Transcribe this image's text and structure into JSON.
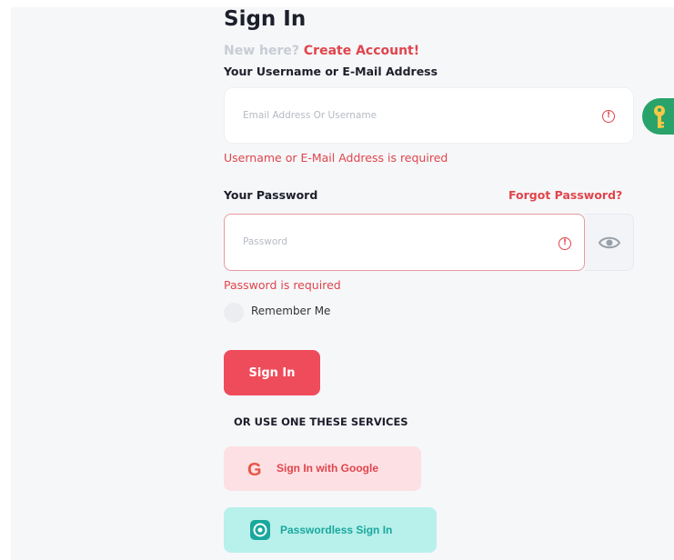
{
  "header": {
    "title": "Sign In",
    "new_here": "New here?",
    "create_account": "Create Account!"
  },
  "username": {
    "label": "Your Username or E-Mail Address",
    "placeholder": "Email Address Or Username",
    "value": "",
    "error": "Username or E-Mail Address is required",
    "error_icon": "!"
  },
  "password": {
    "label": "Your Password",
    "forgot": "Forgot Password?",
    "placeholder": "Password",
    "value": "",
    "error": "Password is required",
    "error_icon": "!"
  },
  "remember": {
    "label": "Remember Me",
    "checked": false
  },
  "actions": {
    "sign_in": "Sign In",
    "or_text": "OR USE ONE THESE SERVICES",
    "google_glyph": "G",
    "google": "Sign In with Google",
    "passwordless": "Passwordless Sign In"
  },
  "colors": {
    "accent": "#ef4c5b",
    "error": "#e0454c",
    "passwordless_bg": "#b8f0ec",
    "google_bg": "#fde0e3",
    "key_badge": "#2aa36a"
  },
  "icons": {
    "username_error": "exclamation-circle-icon",
    "password_error": "exclamation-circle-icon",
    "show_password": "eye-icon",
    "password_manager": "key-icon",
    "google": "google-icon",
    "passwordless": "passwordless-icon"
  }
}
